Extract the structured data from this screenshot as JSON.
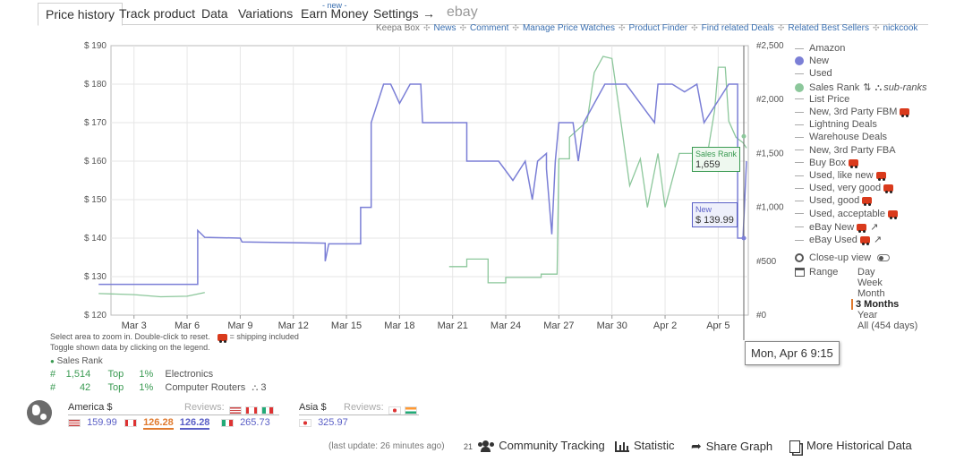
{
  "tabs": [
    {
      "label": "Price history"
    },
    {
      "label": "Track product"
    },
    {
      "label": "Data"
    },
    {
      "label": "Variations"
    },
    {
      "label": "Earn Money",
      "tag": "- new -"
    },
    {
      "label": "Settings"
    },
    {
      "label": "→"
    },
    {
      "label": "ebay"
    }
  ],
  "links": [
    "Keepa Box",
    "News",
    "Comment",
    "Manage Price Watches",
    "Product Finder",
    "Find related Deals",
    "Related Best Sellers",
    "nickcook"
  ],
  "link_separator": "✣",
  "chart_data": {
    "type": "line",
    "x_ticks": [
      "Mar 3",
      "Mar 6",
      "Mar 9",
      "Mar 12",
      "Mar 15",
      "Mar 18",
      "Mar 21",
      "Mar 24",
      "Mar 27",
      "Mar 30",
      "Apr 2",
      "Apr 5"
    ],
    "y_left_ticks": [
      "$ 190",
      "$ 180",
      "$ 170",
      "$ 160",
      "$ 150",
      "$ 140",
      "$ 130",
      "$ 120"
    ],
    "y_right_ticks": [
      "#2,500",
      "#2,000",
      "#1,500",
      "#1,000",
      "#500",
      "#0"
    ],
    "ylim_left": [
      120,
      190
    ],
    "ylim_right": [
      0,
      2500
    ],
    "series": [
      {
        "name": "New",
        "color": "#7b7fd6",
        "axis": "left",
        "points": [
          [
            "Mar 1",
            128
          ],
          [
            "Mar 6.6",
            128
          ],
          [
            "Mar 6.6",
            142
          ],
          [
            "Mar 7",
            140.2
          ],
          [
            "Mar 9",
            140
          ],
          [
            "Mar 9.1",
            139
          ],
          [
            "Mar 13.8",
            138.7
          ],
          [
            "Mar 13.8",
            134
          ],
          [
            "Mar 14",
            138.5
          ],
          [
            "Mar 15.8",
            138.5
          ],
          [
            "Mar 15.8",
            148
          ],
          [
            "Mar 16.4",
            148
          ],
          [
            "Mar 16.4",
            170
          ],
          [
            "Mar 17.1",
            180
          ],
          [
            "Mar 17.5",
            180
          ],
          [
            "Mar 18",
            175
          ],
          [
            "Mar 18.6",
            180
          ],
          [
            "Mar 19.2",
            180
          ],
          [
            "Mar 19.3",
            170
          ],
          [
            "Mar 21.8",
            170
          ],
          [
            "Mar 21.8",
            160
          ],
          [
            "Mar 23.6",
            160
          ],
          [
            "Mar 24.4",
            155
          ],
          [
            "Mar 25.1",
            160
          ],
          [
            "Mar 25.5",
            150
          ],
          [
            "Mar 25.8",
            160
          ],
          [
            "Mar 26.3",
            162
          ],
          [
            "Mar 26.3",
            158
          ],
          [
            "Mar 26.6",
            141
          ],
          [
            "Mar 26.8",
            160
          ],
          [
            "Mar 27",
            170
          ],
          [
            "Mar 27.8",
            170
          ],
          [
            "Mar 28.1",
            160
          ],
          [
            "Mar 28.4",
            170
          ],
          [
            "Mar 29.6",
            180
          ],
          [
            "Mar 30.8",
            180
          ],
          [
            "Apr 1.4",
            170
          ],
          [
            "Apr 1.6",
            180
          ],
          [
            "Apr 2.4",
            180
          ],
          [
            "Apr 3.1",
            178
          ],
          [
            "Apr 3.8",
            180
          ],
          [
            "Apr 4.2",
            170
          ],
          [
            "Apr 5.6",
            180
          ],
          [
            "Apr 6.1",
            180
          ],
          [
            "Apr 6.1",
            140
          ],
          [
            "Apr 6.4",
            140
          ],
          [
            "Apr 6.6",
            160
          ]
        ]
      },
      {
        "name": "Sales Rank",
        "color": "#8cc79b",
        "axis": "right",
        "points": [
          [
            "Mar 1",
            200
          ],
          [
            "Mar 3",
            190
          ],
          [
            "Mar 4.5",
            170
          ],
          [
            "Mar 6",
            175
          ],
          [
            "Mar 7",
            210
          ],
          [
            "Mar 20.8",
            450
          ],
          [
            "Mar 21.8",
            450
          ],
          [
            "Mar 21.8",
            520
          ],
          [
            "Mar 23",
            520
          ],
          [
            "Mar 23",
            300
          ],
          [
            "Mar 24",
            300
          ],
          [
            "Mar 24",
            350
          ],
          [
            "Mar 26",
            350
          ],
          [
            "Mar 26",
            380
          ],
          [
            "Mar 26.9",
            380
          ],
          [
            "Mar 27",
            1450
          ],
          [
            "Mar 27.6",
            1450
          ],
          [
            "Mar 27.6",
            1650
          ],
          [
            "Mar 28.6",
            1800
          ],
          [
            "Mar 29",
            2250
          ],
          [
            "Mar 29.5",
            2400
          ],
          [
            "Mar 30",
            2380
          ],
          [
            "Mar 30.5",
            1800
          ],
          [
            "Mar 31",
            1200
          ],
          [
            "Mar 31.6",
            1450
          ],
          [
            "Apr 1",
            1000
          ],
          [
            "Apr 1.6",
            1500
          ],
          [
            "Apr 2",
            1000
          ],
          [
            "Apr 2.8",
            1500
          ],
          [
            "Apr 3.6",
            1500
          ],
          [
            "Apr 4.4",
            1500
          ],
          [
            "Apr 4.8",
            1900
          ],
          [
            "Apr 5",
            2300
          ],
          [
            "Apr 5.4",
            2300
          ],
          [
            "Apr 5.6",
            1800
          ],
          [
            "Apr 6",
            1650
          ],
          [
            "Apr 6.4",
            1600
          ],
          [
            "Apr 6.6",
            1550
          ]
        ]
      }
    ],
    "grid": true
  },
  "tooltips": {
    "sales_rank": {
      "label": "Sales Rank",
      "value": "1,659",
      "color": "#3a9a52"
    },
    "new": {
      "label": "New",
      "value": "$ 139.99",
      "color": "#5a5fc6"
    },
    "date": "Mon, Apr 6 9:15"
  },
  "legend": {
    "items": [
      {
        "label": "Amazon",
        "kind": "line",
        "color": "#aaa"
      },
      {
        "label": "New",
        "kind": "dot",
        "color": "#7b7fd6"
      },
      {
        "label": "Used",
        "kind": "line",
        "color": "#aaa"
      },
      {
        "label": "Sales Rank",
        "kind": "dot",
        "color": "#8cc79b",
        "extra": "sub-ranks"
      },
      {
        "label": "List Price",
        "kind": "line",
        "color": "#aaa"
      },
      {
        "label": "New, 3rd Party FBM",
        "kind": "line",
        "color": "#aaa",
        "truck": true
      },
      {
        "label": "Lightning Deals",
        "kind": "line",
        "color": "#aaa"
      },
      {
        "label": "Warehouse Deals",
        "kind": "line",
        "color": "#aaa"
      },
      {
        "label": "New, 3rd Party FBA",
        "kind": "line",
        "color": "#aaa"
      },
      {
        "label": "Buy Box",
        "kind": "line",
        "color": "#aaa",
        "truck": true
      },
      {
        "label": "Used, like new",
        "kind": "line",
        "color": "#aaa",
        "truck": true
      },
      {
        "label": "Used, very good",
        "kind": "line",
        "color": "#aaa",
        "truck": true
      },
      {
        "label": "Used, good",
        "kind": "line",
        "color": "#aaa",
        "truck": true
      },
      {
        "label": "Used, acceptable",
        "kind": "line",
        "color": "#aaa",
        "truck": true
      },
      {
        "label": "eBay New",
        "kind": "line",
        "color": "#aaa",
        "truck": true,
        "ext": true
      },
      {
        "label": "eBay Used",
        "kind": "line",
        "color": "#aaa",
        "truck": true,
        "ext": true
      }
    ],
    "closeup": "Close-up view",
    "range_label": "Range",
    "ranges": [
      "Day",
      "Week",
      "Month",
      "3 Months",
      "Year",
      "All (454 days)"
    ],
    "active_range": "3 Months",
    "accent": "#e07a2e"
  },
  "hints": {
    "line1": "Select area to zoom in. Double-click to reset.",
    "shipping": "= shipping included",
    "line2": "Toggle shown data by clicking on the legend."
  },
  "sales_rank_block": {
    "title": "Sales Rank",
    "rows": [
      {
        "hash": "#",
        "rank": "1,514",
        "top": "Top",
        "pct": "1%",
        "category": "Electronics"
      },
      {
        "hash": "#",
        "rank": "42",
        "top": "Top",
        "pct": "1%",
        "category": "Computer Routers",
        "sub": "3"
      }
    ]
  },
  "prices": {
    "america_label": "America $",
    "asia_label": "Asia $",
    "reviews_label": "Reviews:",
    "us": "159.99",
    "ca": "126.28",
    "ca2": "126.28",
    "mx": "265.73",
    "jp": "325.97"
  },
  "footer": {
    "last_update": "(last update: 26 minutes ago)",
    "tracking_count": "21",
    "community": "Community Tracking",
    "statistic": "Statistic",
    "share": "Share Graph",
    "more": "More Historical Data"
  }
}
